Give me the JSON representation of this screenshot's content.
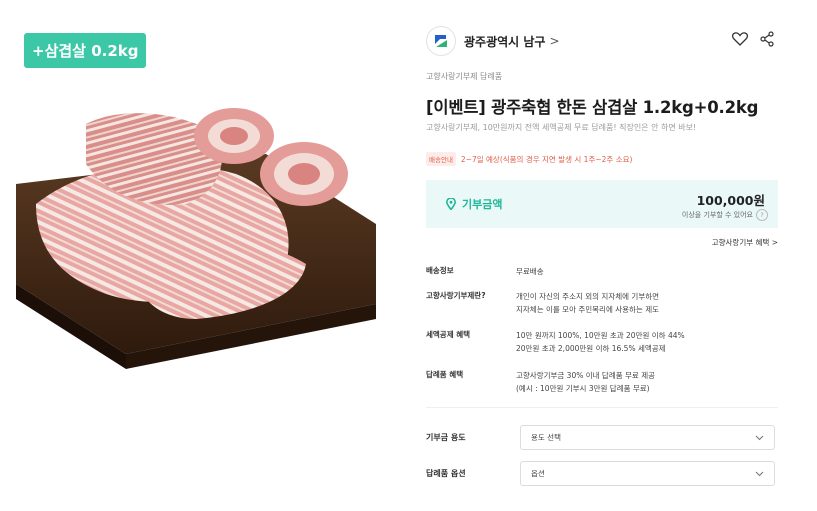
{
  "product_image": {
    "badge": "+삼겹살 0.2kg"
  },
  "seller": {
    "name": "광주광역시 남구",
    "arrow": ">",
    "colors": {
      "blue": "#2460c9",
      "green": "#2fb37a"
    }
  },
  "header_icons": [
    "heart-icon",
    "share-icon"
  ],
  "category": "고향사랑기부제 답례품",
  "title": "[이벤트] 광주축협 한돈 삼겹살 1.2kg+0.2kg",
  "subtitle": "고향사랑기부제, 10만원까지 전액 세액공제 무료 답례품! 직장인은 안 하면 바보!",
  "shipping_note": {
    "tag": "배송안내",
    "text": "2~7일 예상(식품의 경우 지연 발생 시 1주~2주 소요)"
  },
  "donation": {
    "label": "기부금액",
    "amount": "100,000원",
    "note": "이상을 기부할 수 있어요",
    "help": "?",
    "accent": "#1eb69a",
    "box_bg": "#eaf9f7"
  },
  "benefit_link": "고향사랑기부 혜택 >",
  "info_rows": [
    {
      "label": "배송정보",
      "value": [
        "무료배송"
      ]
    },
    {
      "label": "고향사랑기부제란?",
      "value": [
        "개인이 자신의 주소지 외의 지자체에 기부하면",
        "지자체는 이를 모아 주민복리에 사용하는 제도"
      ]
    },
    {
      "label": "세액공제 혜택",
      "value": [
        "10만 원까지 100%, 10만원 초과 20만원 이하 44%",
        "20만원 초과 2,000만원 이하 16.5% 세액공제"
      ]
    },
    {
      "label": "답례품 혜택",
      "value": [
        "고향사랑기부금 30% 이내 답례품 무료 제공",
        "(예시 : 10만원 기부시 3만원 답례품 무료)"
      ]
    }
  ],
  "selects": [
    {
      "label": "기부금 용도",
      "value": "용도 선택"
    },
    {
      "label": "답례품 옵션",
      "value": "옵션"
    }
  ]
}
